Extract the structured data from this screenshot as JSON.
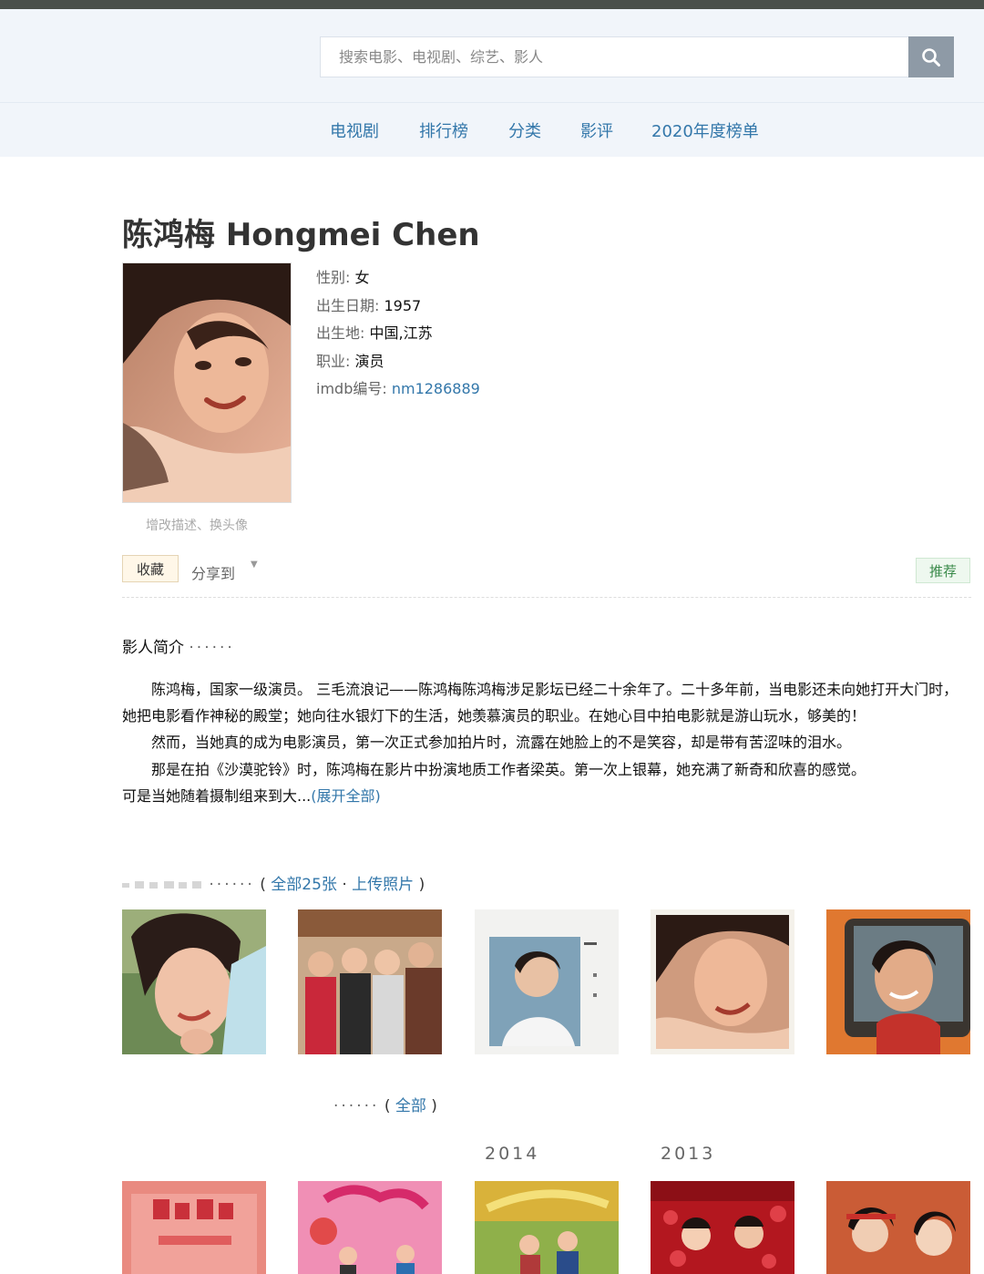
{
  "search": {
    "placeholder": "搜索电影、电视剧、综艺、影人"
  },
  "nav": [
    "电视剧",
    "排行榜",
    "分类",
    "影评",
    "2020年度榜单"
  ],
  "person": {
    "title": "陈鸿梅 Hongmei Chen",
    "portrait_caption": "增改描述、换头像",
    "info": {
      "gender_label": "性别:",
      "gender": "女",
      "birth_label": "出生日期:",
      "birth": "1957",
      "place_label": "出生地:",
      "place": "中国,江苏",
      "job_label": "职业:",
      "job": "演员",
      "imdb_label": "imdb编号:",
      "imdb": "nm1286889"
    }
  },
  "actions": {
    "collect": "收藏",
    "share": "分享到",
    "share_arrow": "▼",
    "recommend": "推荐"
  },
  "bio": {
    "heading": "影人简介",
    "dots": "······",
    "p1": "陈鸿梅，国家一级演员。 三毛流浪记——陈鸿梅陈鸿梅涉足影坛已经二十余年了。二十多年前，当电影还未向她打开大门时，她把电影看作神秘的殿堂；她向往水银灯下的生活，她羡慕演员的职业。在她心目中拍电影就是游山玩水，够美的！",
    "p2": "然而，当她真的成为电影演员，第一次正式参加拍片时，流露在她脸上的不是笑容，却是带有苦涩味的泪水。",
    "p3": "那是在拍《沙漠驼铃》时，陈鸿梅在影片中扮演地质工作者梁英。第一次上银幕，她充满了新奇和欣喜的感觉。",
    "p4_lead": "可是当她随着摄制组来到大...",
    "expand": "(展开全部)"
  },
  "photos": {
    "dots": "······",
    "open": "(",
    "all": "全部25张",
    "sep": "·",
    "upload": "上传照片",
    "close": ")"
  },
  "works": {
    "dots": "······",
    "open": "(",
    "all": "全部",
    "close": ")",
    "years": [
      "2014",
      "2013"
    ]
  },
  "colors": {
    "link": "#3377aa",
    "header_bg": "#f1f5fa",
    "search_btn": "#8e9aa6",
    "recommend": "#3a8a4a"
  }
}
